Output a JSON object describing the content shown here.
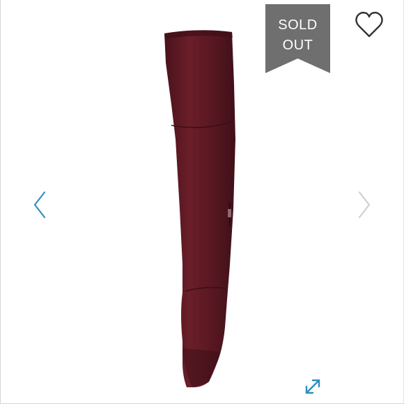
{
  "badge": {
    "line1": "SOLD",
    "line2": "OUT"
  },
  "colors": {
    "badge_bg": "#6f6f6f",
    "accent": "#2e8fbd",
    "boot": "#5e1a24"
  },
  "icons": {
    "like": "heart-outline-icon",
    "prev": "chevron-left-icon",
    "next": "chevron-right-icon",
    "expand": "expand-arrows-icon"
  }
}
